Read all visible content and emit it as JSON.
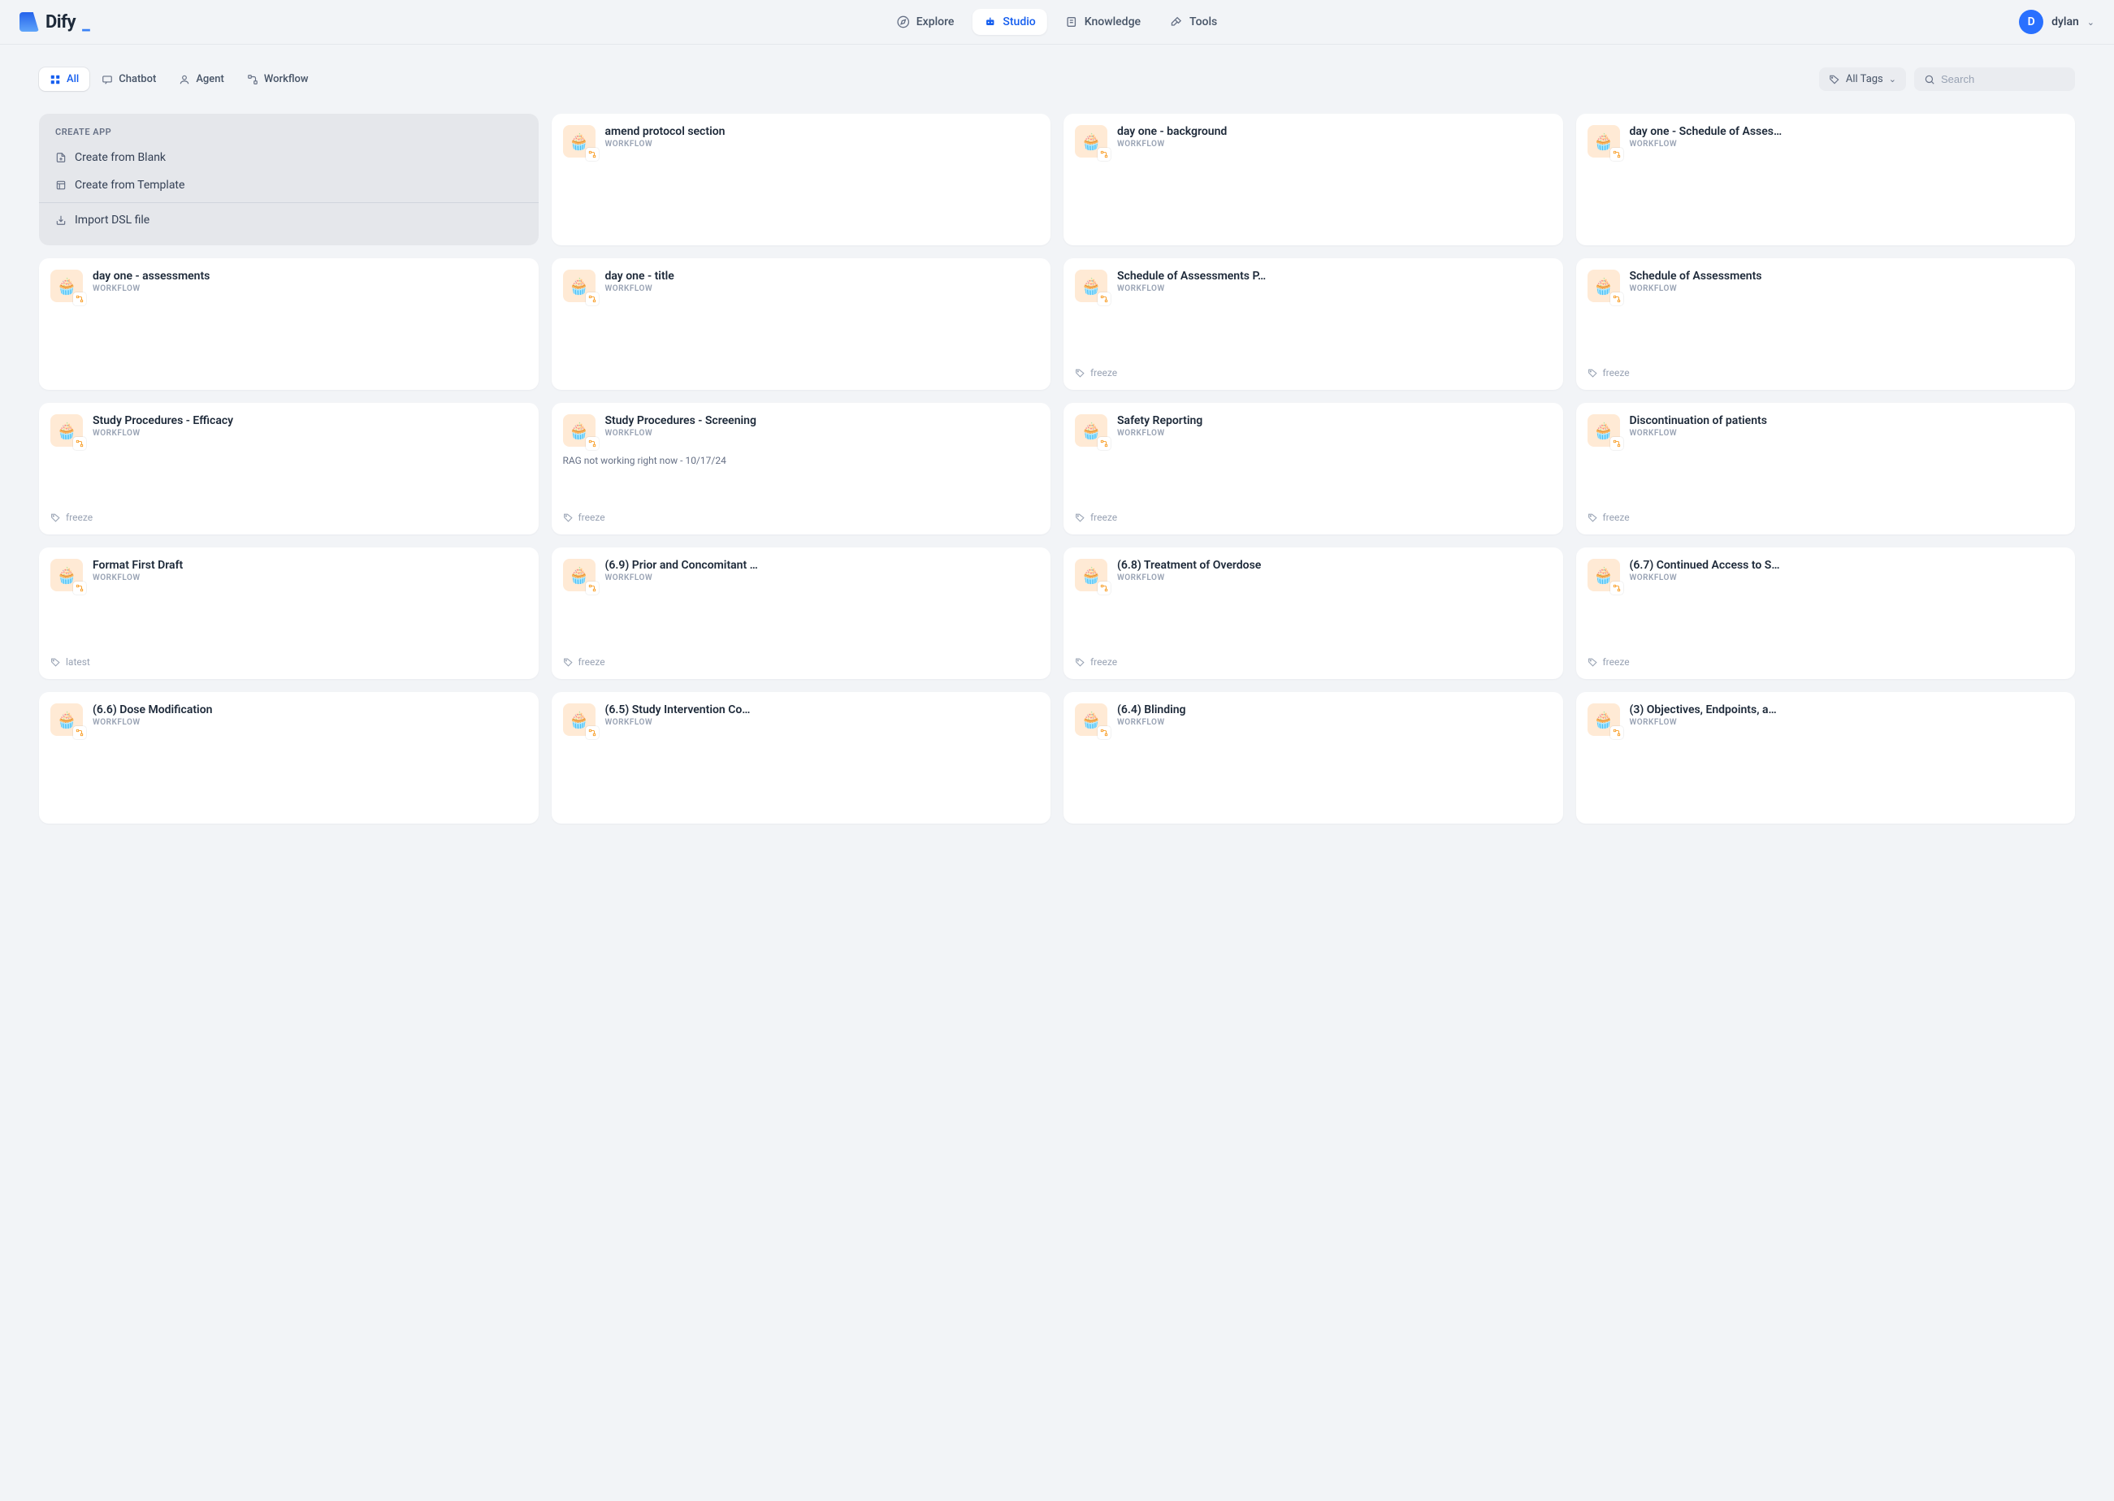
{
  "brand": {
    "name": "Dify"
  },
  "nav": {
    "explore": "Explore",
    "studio": "Studio",
    "knowledge": "Knowledge",
    "tools": "Tools"
  },
  "user": {
    "initial": "D",
    "name": "dylan"
  },
  "filters": {
    "all": "All",
    "chatbot": "Chatbot",
    "agent": "Agent",
    "workflow": "Workflow"
  },
  "tags_dropdown": "All Tags",
  "search": {
    "placeholder": "Search"
  },
  "create": {
    "header": "CREATE APP",
    "blank": "Create from Blank",
    "template": "Create from Template",
    "import": "Import DSL file"
  },
  "type_label": "WORKFLOW",
  "apps": [
    {
      "title": "amend protocol section",
      "desc": "",
      "tag": ""
    },
    {
      "title": "day one - background",
      "desc": "",
      "tag": ""
    },
    {
      "title": "day one - Schedule of Asses…",
      "desc": "",
      "tag": ""
    },
    {
      "title": "day one - assessments",
      "desc": "",
      "tag": ""
    },
    {
      "title": "day one - title",
      "desc": "",
      "tag": ""
    },
    {
      "title": "Schedule of Assessments P…",
      "desc": "",
      "tag": "freeze"
    },
    {
      "title": "Schedule of Assessments",
      "desc": "",
      "tag": "freeze"
    },
    {
      "title": "Study Procedures - Efficacy",
      "desc": "",
      "tag": "freeze"
    },
    {
      "title": "Study Procedures - Screening",
      "desc": "RAG not working right now - 10/17/24",
      "tag": "freeze"
    },
    {
      "title": "Safety Reporting",
      "desc": "",
      "tag": "freeze"
    },
    {
      "title": "Discontinuation of patients",
      "desc": "",
      "tag": "freeze"
    },
    {
      "title": "Format First Draft",
      "desc": "",
      "tag": "latest"
    },
    {
      "title": "(6.9) Prior and Concomitant …",
      "desc": "",
      "tag": "freeze"
    },
    {
      "title": "(6.8) Treatment of Overdose",
      "desc": "",
      "tag": "freeze"
    },
    {
      "title": "(6.7) Continued Access to S…",
      "desc": "",
      "tag": "freeze"
    },
    {
      "title": "(6.6) Dose Modification",
      "desc": "",
      "tag": ""
    },
    {
      "title": "(6.5) Study Intervention Co…",
      "desc": "",
      "tag": ""
    },
    {
      "title": "(6.4) Blinding",
      "desc": "",
      "tag": ""
    },
    {
      "title": "(3) Objectives, Endpoints, a…",
      "desc": "",
      "tag": ""
    }
  ]
}
